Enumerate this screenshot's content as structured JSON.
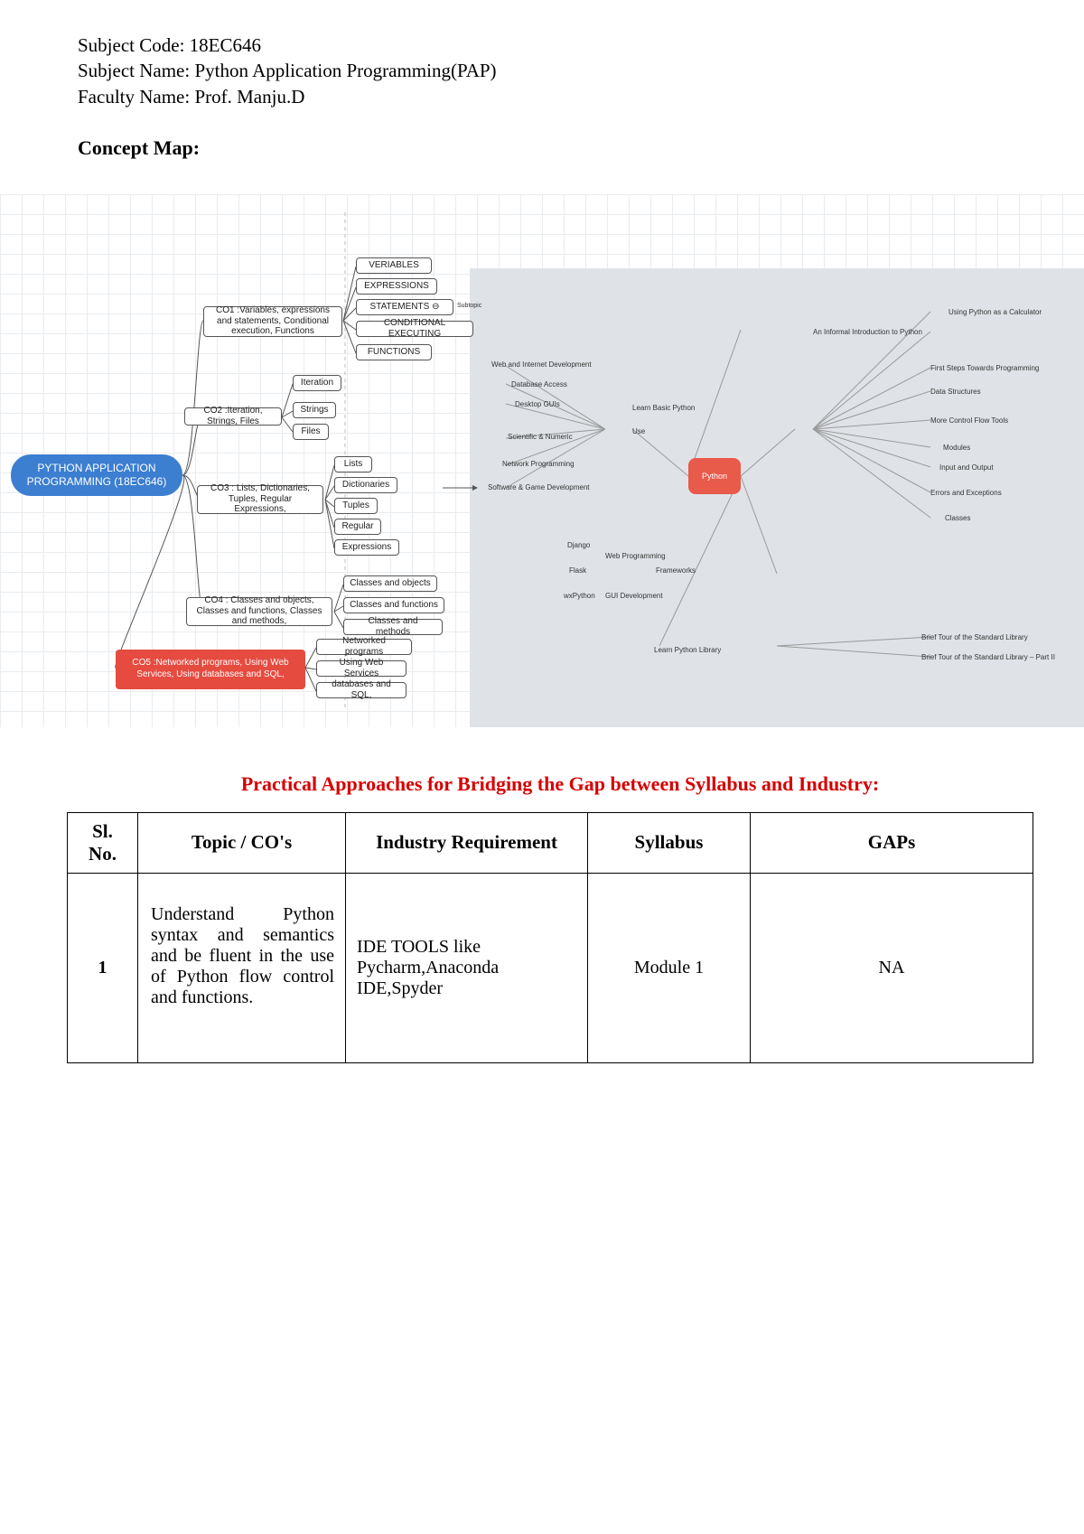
{
  "header": {
    "subject_code_label": "Subject Code: ",
    "subject_code": "18EC646",
    "subject_name_label": "Subject Name: ",
    "subject_name": "Python Application Programming(PAP)",
    "faculty_label": "Faculty Name: ",
    "faculty": "Prof. Manju.D"
  },
  "concept_map_title": "Concept Map:",
  "mindmap": {
    "root": "PYTHON APPLICATION PROGRAMMING (18EC646)",
    "co1": "CO1 :Variables, expressions and statements, Conditional execution, Functions",
    "co1_items": [
      "VERIABLES",
      "EXPRESSIONS",
      "STATEMENTS ⊖",
      "CONDITIONAL EXECUTING",
      "FUNCTIONS"
    ],
    "statements_sub": "Subtopic",
    "co2": "CO2 :Iteration, Strings, Files",
    "co2_items": [
      "Iteration",
      "Strings",
      "Files"
    ],
    "co3": "CO3 : Lists, Dictionaries, Tuples, Regular Expressions,",
    "co3_items": [
      "Lists",
      "Dictionaries",
      "Tuples",
      "Regular",
      "Expressions"
    ],
    "co4": "CO4 : Classes and objects, Classes and functions, Classes and methods,",
    "co4_items": [
      "Classes and objects",
      "Classes and functions",
      "Classes and methods"
    ],
    "co5": "CO5 :Networked programs, Using Web Services, Using databases and SQL,",
    "co5_items": [
      "Networked programs",
      "Using Web Services",
      "databases and SQL,"
    ],
    "left_group": {
      "title": "Learn Basic Python",
      "items": [
        "Web and Internet Development",
        "Database Access",
        "Desktop GUIs",
        "Scientific & Numeric",
        "Network Programming",
        "Software & Game Development"
      ],
      "use": "Use"
    },
    "frameworks": {
      "django": "Django",
      "web": "Web Programming",
      "flask": "Flask",
      "fw": "Frameworks",
      "wxpython": "wxPython",
      "gui": "GUI Development"
    },
    "right_group": {
      "items": [
        "Using Python as a Calculator",
        "An Informal Introduction to Python",
        "First Steps Towards Programming",
        "Data Structures",
        "More Control Flow Tools",
        "Modules",
        "Input and Output",
        "Errors and Exceptions",
        "Classes"
      ]
    },
    "lib": {
      "label": "Learn Python Library",
      "items": [
        "Brief Tour of the Standard Library",
        "Brief Tour of the Standard Library – Part II"
      ]
    },
    "python": "Python"
  },
  "section_title": "Practical Approaches for Bridging the Gap between Syllabus and Industry:",
  "table": {
    "headers": {
      "sl": "Sl. No.",
      "topic": "Topic / CO's",
      "ind": "Industry Requirement",
      "syl": "Syllabus",
      "gaps": "GAPs"
    },
    "rows": [
      {
        "sl": "1",
        "topic": "Understand Python syntax and semantics and be fluent in the use of Python flow control and functions.",
        "ind": "IDE TOOLS like Pycharm,Anaconda IDE,Spyder",
        "syl": "Module 1",
        "gaps": "NA"
      }
    ]
  }
}
